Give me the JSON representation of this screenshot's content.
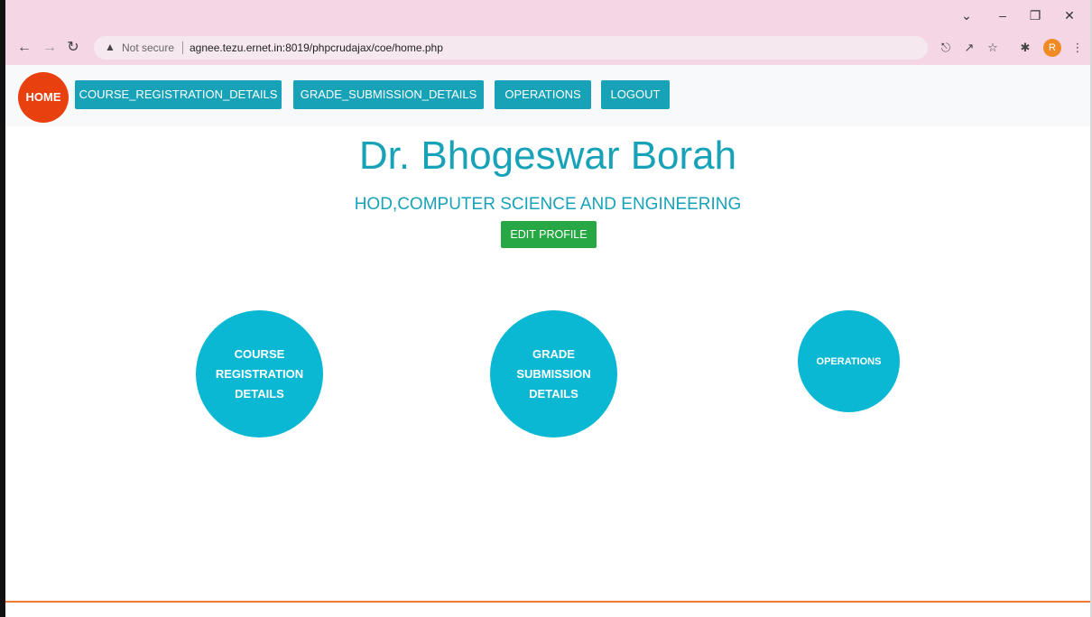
{
  "browser": {
    "security_text": "Not secure",
    "url": "agnee.tezu.ernet.in:8019/phpcrudajax/coe/home.php",
    "profile_initial": "R",
    "icons": [
      "back-arrow-icon",
      "forward-arrow-icon",
      "reload-icon",
      "warning-icon",
      "key-icon",
      "share-icon",
      "star-icon",
      "extensions-icon",
      "menu-icon"
    ]
  },
  "navbar": {
    "home_label": "HOME",
    "links": [
      "COURSE_REGISTRATION_DETAILS",
      "GRADE_SUBMISSION_DETAILS",
      "OPERATIONS",
      "LOGOUT"
    ],
    "home_color": "#e8410f",
    "link_color": "#17a2b8"
  },
  "profile": {
    "name": "Dr. Bhogeswar Borah",
    "designation": "HOD,COMPUTER SCIENCE AND ENGINEERING",
    "edit_label": "EDIT PROFILE"
  },
  "tiles": [
    {
      "lines": [
        "COURSE",
        "REGISTRATION",
        "DETAILS"
      ]
    },
    {
      "lines": [
        "GRADE",
        "SUBMISSION",
        "DETAILS"
      ]
    },
    {
      "lines": [
        "OPERATIONS"
      ]
    }
  ],
  "colors": {
    "accent": "#17a2b8",
    "tile": "#0ab8d3",
    "edit_button": "#28a745",
    "footer_line": "#f07a3a",
    "chrome": "#f4d6e5"
  }
}
